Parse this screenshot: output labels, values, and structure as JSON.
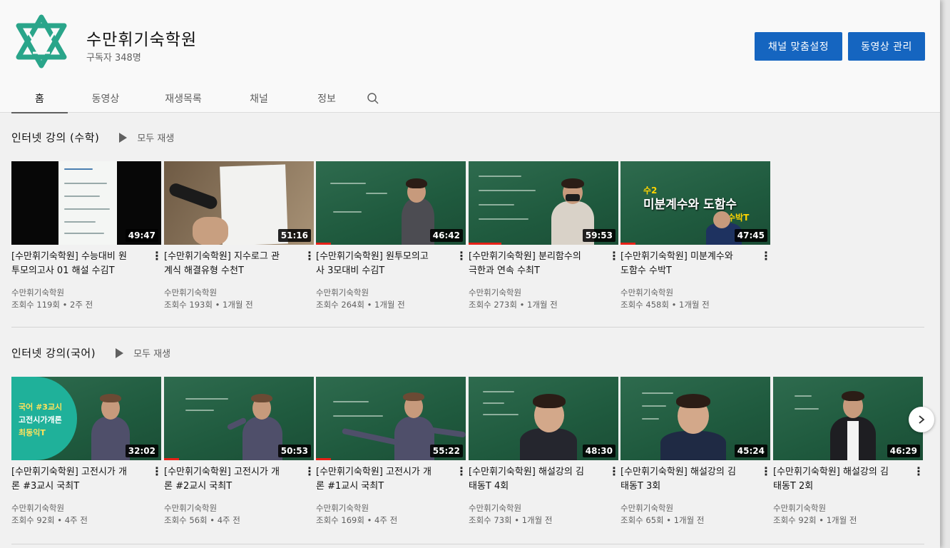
{
  "channel": {
    "name": "수만휘기숙학원",
    "subscribers": "구독자 348명"
  },
  "buttons": {
    "customize": "채널 맞춤설정",
    "manage": "동영상 관리"
  },
  "tabs": [
    {
      "label": "홈",
      "active": true
    },
    {
      "label": "동영상",
      "active": false
    },
    {
      "label": "재생목록",
      "active": false
    },
    {
      "label": "채널",
      "active": false
    },
    {
      "label": "정보",
      "active": false
    }
  ],
  "icons": {
    "logo": "channel-logo-icon",
    "search": "search-icon",
    "play": "play-icon",
    "more": "more-vert-icon",
    "next": "chevron-right-icon"
  },
  "colors": {
    "accent": "#1565c0",
    "logo": "#2aa58a",
    "progress": "#e62117"
  },
  "sections": [
    {
      "title": "인터넷 강의 (수학)",
      "play_all": "모두 재생",
      "videos": [
        {
          "line1": "[수만휘기숙학원] 수능대비 원",
          "line2": "투모의고사 01 해설 수김T",
          "channel": "수만휘기숙학원",
          "meta": "조회수 119회 • 2주 전",
          "duration": "49:47",
          "watched": 0
        },
        {
          "line1": "[수만휘기숙학원] 지수로그 관",
          "line2": "계식 해결유형 수천T",
          "channel": "수만휘기숙학원",
          "meta": "조회수 193회 • 1개월 전",
          "duration": "51:16",
          "watched": 0
        },
        {
          "line1": "[수만휘기숙학원] 원투모의고",
          "line2": "사 3모대비 수김T",
          "channel": "수만휘기숙학원",
          "meta": "조회수 264회 • 1개월 전",
          "duration": "46:42",
          "watched": 0.1
        },
        {
          "line1": "[수만휘기숙학원] 분리함수의",
          "line2": "극한과 연속 수최T",
          "channel": "수만휘기숙학원",
          "meta": "조회수 273회 • 1개월 전",
          "duration": "59:53",
          "watched": 0.22
        },
        {
          "line1": "[수만휘기숙학원] 미분계수와",
          "line2": "도함수 수박T",
          "channel": "수만휘기숙학원",
          "meta": "조회수 458회 • 1개월 전",
          "duration": "47:45",
          "watched": 0.1,
          "overlay": {
            "small": "수2",
            "big": "미분계수와 도함수",
            "teacher": "수박T"
          }
        }
      ]
    },
    {
      "title": "인터넷 강의(국어)",
      "play_all": "모두 재생",
      "videos": [
        {
          "line1": "[수만휘기숙학원] 고전시가 개",
          "line2": "론 #3교시 국최T",
          "channel": "수만휘기숙학원",
          "meta": "조회수 92회 • 4주 전",
          "duration": "32:02",
          "watched": 0,
          "overlay": {
            "line1": "국어 #3교시",
            "line2": "고전시가개론",
            "line3": "최동익T"
          }
        },
        {
          "line1": "[수만휘기숙학원] 고전시가 개",
          "line2": "론 #2교시 국최T",
          "channel": "수만휘기숙학원",
          "meta": "조회수 56회 • 4주 전",
          "duration": "50:53",
          "watched": 0.1
        },
        {
          "line1": "[수만휘기숙학원] 고전시가 개",
          "line2": "론 #1교시 국최T",
          "channel": "수만휘기숙학원",
          "meta": "조회수 169회 • 4주 전",
          "duration": "55:22",
          "watched": 0.1
        },
        {
          "line1": "[수만휘기숙학원] 해설강의 김",
          "line2": "태동T 4회",
          "channel": "수만휘기숙학원",
          "meta": "조회수 73회 • 1개월 전",
          "duration": "48:30",
          "watched": 0
        },
        {
          "line1": "[수만휘기숙학원] 해설강의 김",
          "line2": "태동T 3회",
          "channel": "수만휘기숙학원",
          "meta": "조회수 65회 • 1개월 전",
          "duration": "45:24",
          "watched": 0
        },
        {
          "line1": "[수만휘기숙학원] 해설강의 김",
          "line2": "태동T 2회",
          "channel": "수만휘기숙학원",
          "meta": "조회수 92회 • 1개월 전",
          "duration": "46:29",
          "watched": 0
        }
      ]
    }
  ]
}
